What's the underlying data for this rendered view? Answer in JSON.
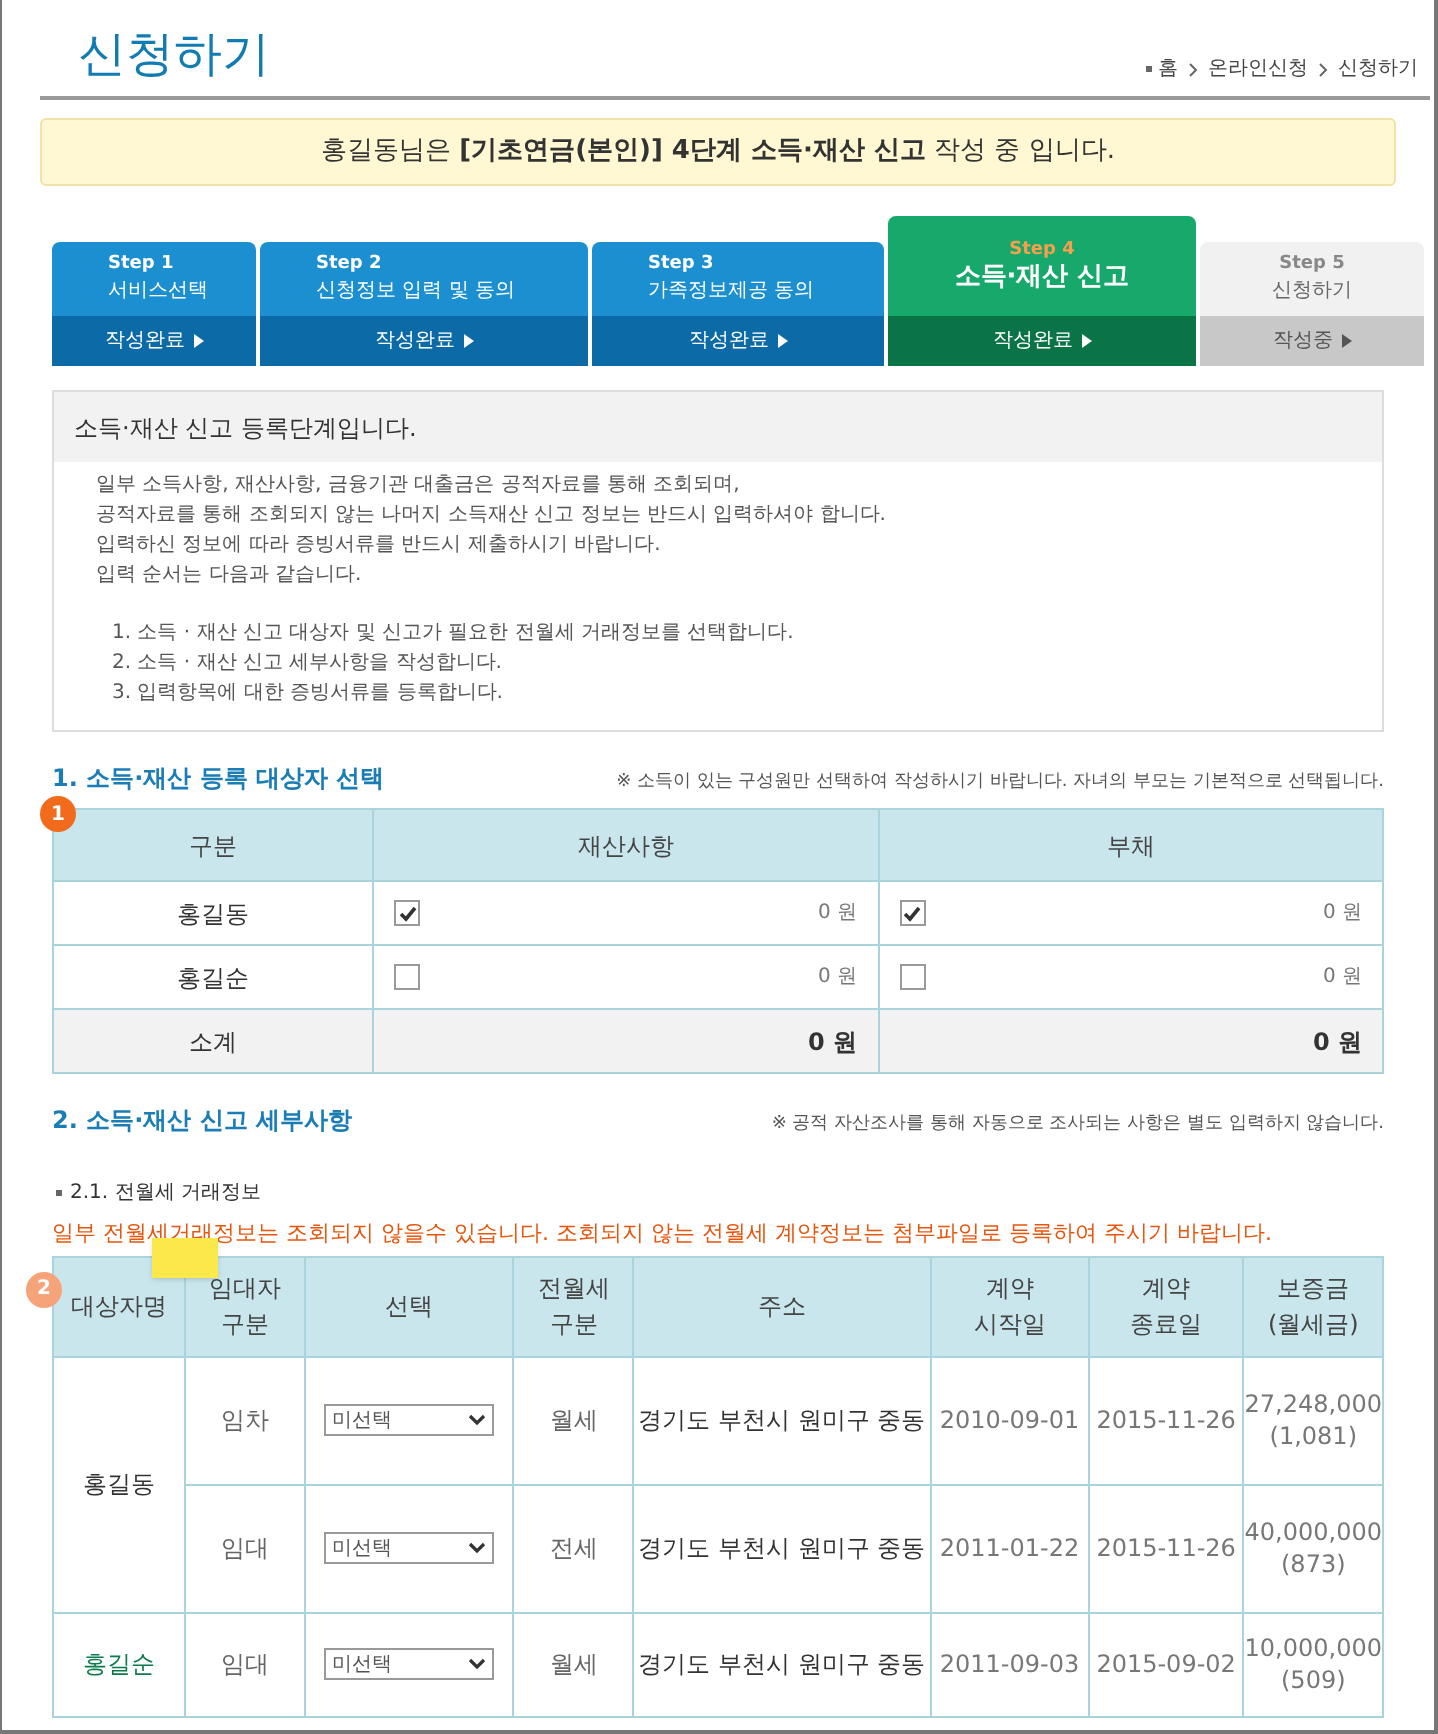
{
  "page": {
    "title": "신청하기",
    "breadcrumb": [
      "홈",
      "온라인신청",
      "신청하기"
    ]
  },
  "banner": "홍길동님은 **[기초연금(본인)] 4단계 소득·재산 신고** 작성 중 입니다.",
  "steps": [
    {
      "label": "Step 1",
      "name": "서비스선택",
      "status": "작성완료",
      "kind": "done"
    },
    {
      "label": "Step 2",
      "name": "신청정보 입력 및 동의",
      "status": "작성완료",
      "kind": "done"
    },
    {
      "label": "Step 3",
      "name": "가족정보제공 동의",
      "status": "작성완료",
      "kind": "done"
    },
    {
      "label": "Step 4",
      "name": "소득·재산 신고",
      "status": "작성완료",
      "kind": "current"
    },
    {
      "label": "Step 5",
      "name": "신청하기",
      "status": "작성중",
      "kind": "pending"
    }
  ],
  "info": {
    "heading": "소득·재산 신고 등록단계입니다.",
    "lines": [
      "일부 소득사항, 재산사항, 금융기관 대출금은 공적자료를 통해 조회되며,",
      "공적자료를 통해 조회되지 않는 나머지 소득재산 신고 정보는 반드시 입력하셔야 합니다.",
      "입력하신 정보에 따라 증빙서류를 반드시 제출하시기 바랍니다.",
      "입력 순서는 다음과 같습니다."
    ],
    "steps": [
      "1. 소득 · 재산 신고 대상자 및 신고가 필요한 전월세 거래정보를 선택합니다.",
      "2. 소득 · 재산 신고 세부사항을 작성합니다.",
      "3. 입력항목에 대한 증빙서류를 등록합니다."
    ]
  },
  "section1": {
    "title": "1. 소득·재산 등록 대상자 선택",
    "note": "※ 소득이 있는 구성원만 선택하여 작성하시기 바랍니다. 자녀의 부모는 기본적으로 선택됩니다.",
    "badge": "1",
    "columns": [
      "구분",
      "재산사항",
      "부채"
    ],
    "rows": [
      {
        "name": "홍길동",
        "property": {
          "checked": true,
          "amount": "0 원"
        },
        "debt": {
          "checked": true,
          "amount": "0 원"
        }
      },
      {
        "name": "홍길순",
        "property": {
          "checked": false,
          "amount": "0 원"
        },
        "debt": {
          "checked": false,
          "amount": "0 원"
        }
      }
    ],
    "total": {
      "label": "소계",
      "property": "0 원",
      "debt": "0 원"
    }
  },
  "section2": {
    "title": "2. 소득·재산 신고 세부사항",
    "note": "※ 공적 자산조사를 통해 자동으로 조사되는 사항은 별도 입력하지 않습니다.",
    "subtitle": "2.1. 전월세 거래정보",
    "warning": "일부 전월세거래정보는 조회되지 않을수 있습니다. 조회되지 않는 전월세 계약정보는 첨부파일로 등록하여 주시기 바랍니다.",
    "badge": "2",
    "columns": [
      [
        "대상자명"
      ],
      [
        "임대자",
        "구분"
      ],
      [
        "선택"
      ],
      [
        "전월세",
        "구분"
      ],
      [
        "주소"
      ],
      [
        "계약",
        "시작일"
      ],
      [
        "계약",
        "종료일"
      ],
      [
        "보증금",
        "(월세금)"
      ]
    ],
    "persons": [
      {
        "name": "홍길동",
        "highlighted": false,
        "contracts": [
          {
            "role": "임차",
            "select": "미선택",
            "type": "월세",
            "address": "경기도 부천시 원미구 중동",
            "start": "2010-09-01",
            "end": "2015-11-26",
            "deposit": "27,248,000",
            "monthly": "(1,081)"
          },
          {
            "role": "임대",
            "select": "미선택",
            "type": "전세",
            "address": "경기도 부천시 원미구 중동",
            "start": "2011-01-22",
            "end": "2015-11-26",
            "deposit": "40,000,000",
            "monthly": "(873)"
          }
        ]
      },
      {
        "name": "홍길순",
        "highlighted": true,
        "contracts": [
          {
            "role": "임대",
            "select": "미선택",
            "type": "월세",
            "address": "경기도 부천시 원미구 중동",
            "start": "2011-09-03",
            "end": "2015-09-02",
            "deposit": "10,000,000",
            "monthly": "(509)"
          }
        ]
      }
    ]
  }
}
